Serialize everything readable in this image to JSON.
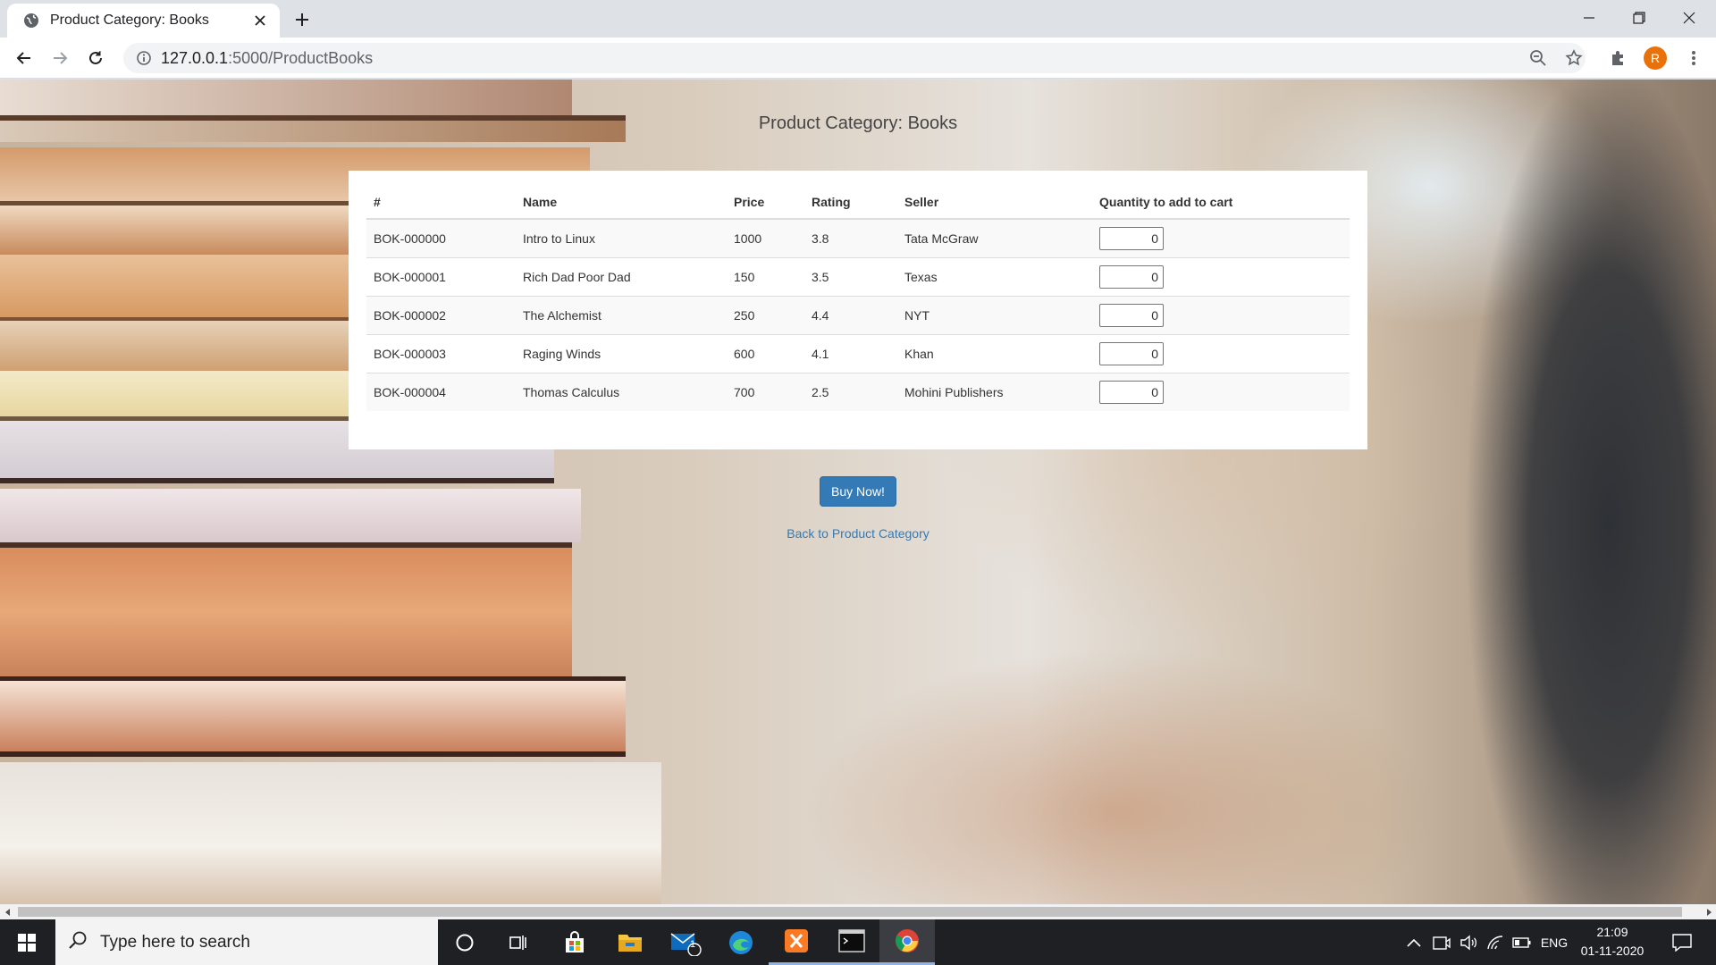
{
  "browser": {
    "tab_title": "Product Category: Books",
    "url_host": "127.0.0.1",
    "url_path": ":5000/ProductBooks",
    "profile_initial": "R"
  },
  "page": {
    "title": "Product Category: Books",
    "table": {
      "headers": [
        "#",
        "Name",
        "Price",
        "Rating",
        "Seller",
        "Quantity to add to cart"
      ],
      "rows": [
        {
          "id": "BOK-000000",
          "name": "Intro to Linux",
          "price": "1000",
          "rating": "3.8",
          "seller": "Tata McGraw",
          "qty": "0"
        },
        {
          "id": "BOK-000001",
          "name": "Rich Dad Poor Dad",
          "price": "150",
          "rating": "3.5",
          "seller": "Texas",
          "qty": "0"
        },
        {
          "id": "BOK-000002",
          "name": "The Alchemist",
          "price": "250",
          "rating": "4.4",
          "seller": "NYT",
          "qty": "0"
        },
        {
          "id": "BOK-000003",
          "name": "Raging Winds",
          "price": "600",
          "rating": "4.1",
          "seller": "Khan",
          "qty": "0"
        },
        {
          "id": "BOK-000004",
          "name": "Thomas Calculus",
          "price": "700",
          "rating": "2.5",
          "seller": "Mohini Publishers",
          "qty": "0"
        }
      ]
    },
    "buy_label": "Buy Now!",
    "back_label": "Back to Product Category"
  },
  "taskbar": {
    "search_placeholder": "Type here to search",
    "language": "ENG",
    "time": "21:09",
    "date": "01-11-2020",
    "mail_badge": "1"
  },
  "colors": {
    "link": "#337ab7",
    "button": "#337ab7",
    "profile": "#e8710a"
  }
}
